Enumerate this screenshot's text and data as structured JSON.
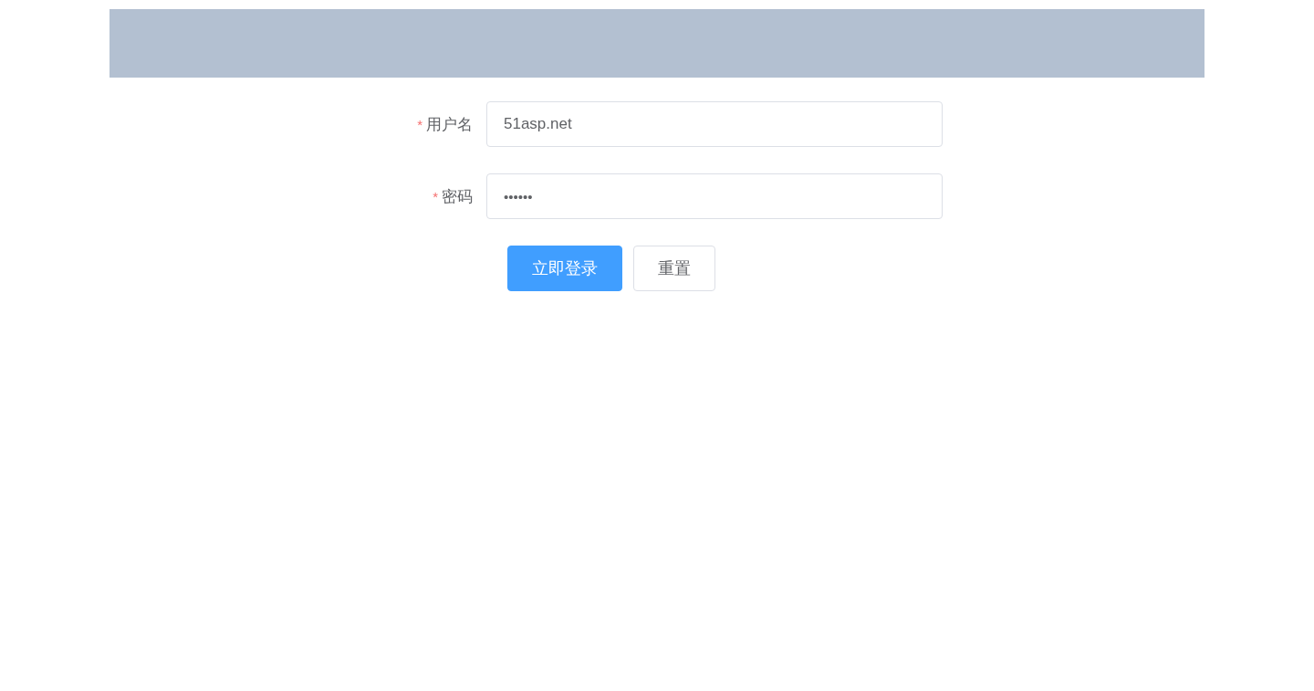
{
  "header": {
    "kind": "banner"
  },
  "fields": [
    {
      "kind": "text",
      "marker": "*",
      "label": "用户名",
      "value": "51asp.net"
    },
    {
      "kind": "password",
      "marker": "*",
      "label": "密码",
      "value": "••••••"
    }
  ],
  "buttons": [
    {
      "label": "立即登录",
      "kind": "primary"
    },
    {
      "label": "重置",
      "kind": "default"
    }
  ]
}
